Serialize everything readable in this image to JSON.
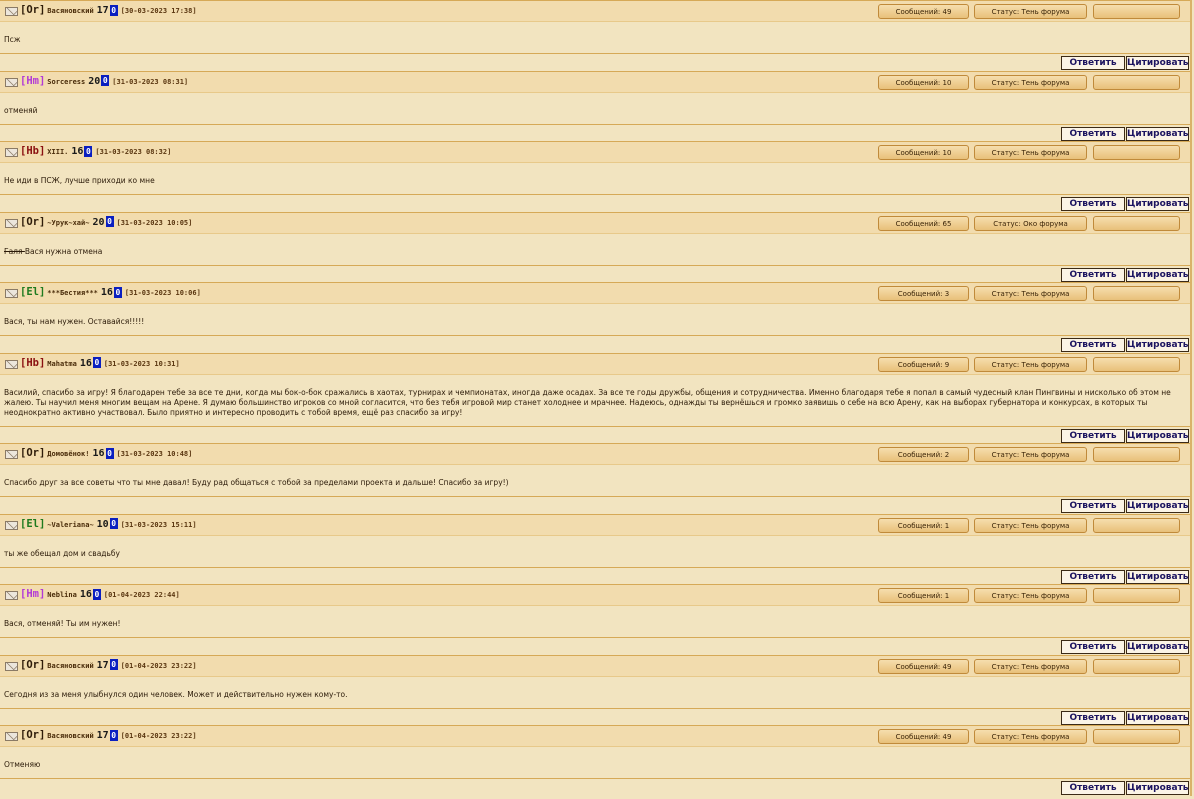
{
  "posts": [
    {
      "clan": "[Or]",
      "clan_color": "#2e1c09",
      "nick": "Васяновский",
      "level": "17",
      "date": "[30-03-2023 17:38]",
      "messages": "Сообщений: 49",
      "status": "Статус: Тень форума",
      "text": "Псж",
      "strike": ""
    },
    {
      "clan": "[Hm]",
      "clan_color": "#b23ad6",
      "nick": "Sorceress",
      "level": "20",
      "date": "[31-03-2023 08:31]",
      "messages": "Сообщений: 10",
      "status": "Статус: Тень форума",
      "text": "отменяй",
      "strike": ""
    },
    {
      "clan": "[Hb]",
      "clan_color": "#8a1010",
      "nick": "XIII.",
      "level": "16",
      "date": "[31-03-2023 08:32]",
      "messages": "Сообщений: 10",
      "status": "Статус: Тень форума",
      "text": "Не иди в ПСЖ, лучше приходи ко мне",
      "strike": ""
    },
    {
      "clan": "[Or]",
      "clan_color": "#2e1c09",
      "nick": "~Урук~хай~",
      "level": "20",
      "date": "[31-03-2023 10:05]",
      "messages": "Сообщений: 65",
      "status": "Статус: Око форума",
      "text": "Вася нужна отмена",
      "strike": "Галя "
    },
    {
      "clan": "[El]",
      "clan_color": "#1e7a1e",
      "nick": "***Бестия***",
      "level": "16",
      "date": "[31-03-2023 10:06]",
      "messages": "Сообщений: 3",
      "status": "Статус: Тень форума",
      "text": "Вася, ты нам нужен. Оставайся!!!!!",
      "strike": ""
    },
    {
      "clan": "[Hb]",
      "clan_color": "#8a1010",
      "nick": "Mahatma",
      "level": "16",
      "date": "[31-03-2023 10:31]",
      "messages": "Сообщений: 9",
      "status": "Статус: Тень форума",
      "text": "Василий, спасибо за игру! Я благодарен тебе за все те дни, когда мы бок-о-бок сражались в хаотах, турнирах и чемпионатах, иногда даже осадах. За все те годы дружбы, общения и сотрудничества. Именно благодаря тебе я попал в самый чудесный клан Пингвины и нисколько об этом не жалею. Ты научил меня многим вещам на Арене. Я думаю большинство игроков со мной согласится, что без тебя игровой мир станет холоднее и мрачнее. Надеюсь, однажды ты вернёшься и громко заявишь о себе на всю Арену, как на выборах губернатора и конкурсах, в которых ты неоднократно активно участвовал. Было приятно и интересно проводить с тобой время, ещё раз спасибо за игру!",
      "strike": ""
    },
    {
      "clan": "[Or]",
      "clan_color": "#2e1c09",
      "nick": "Домовёнок!",
      "level": "16",
      "date": "[31-03-2023 10:48]",
      "messages": "Сообщений: 2",
      "status": "Статус: Тень форума",
      "text": "Спасибо друг за все советы что ты мне давал! Буду рад общаться с тобой за пределами проекта и дальше! Спасибо за игру!)",
      "strike": ""
    },
    {
      "clan": "[El]",
      "clan_color": "#1e7a1e",
      "nick": "~Valeriana~",
      "level": "10",
      "date": "[31-03-2023 15:11]",
      "messages": "Сообщений: 1",
      "status": "Статус: Тень форума",
      "text": "ты же обещал дом и свадьбу",
      "strike": ""
    },
    {
      "clan": "[Hm]",
      "clan_color": "#b23ad6",
      "nick": "Neblina",
      "level": "16",
      "date": "[01-04-2023 22:44]",
      "messages": "Сообщений: 1",
      "status": "Статус: Тень форума",
      "text": "Вася, отменяй! Ты им нужен!",
      "strike": ""
    },
    {
      "clan": "[Or]",
      "clan_color": "#2e1c09",
      "nick": "Васяновский",
      "level": "17",
      "date": "[01-04-2023 23:22]",
      "messages": "Сообщений: 49",
      "status": "Статус: Тень форума",
      "text": "Сегодня из за меня улыбнулся один человек. Может и действительно нужен кому-то.",
      "strike": ""
    },
    {
      "clan": "[Or]",
      "clan_color": "#2e1c09",
      "nick": "Васяновский",
      "level": "17",
      "date": "[01-04-2023 23:22]",
      "messages": "Сообщений: 49",
      "status": "Статус: Тень форума",
      "text": "Отменяю",
      "strike": ""
    }
  ],
  "buttons": {
    "reply": "Ответить",
    "quote": "Цитировать"
  },
  "info_label": "0",
  "icons": {
    "envelope": "envelope-icon"
  }
}
